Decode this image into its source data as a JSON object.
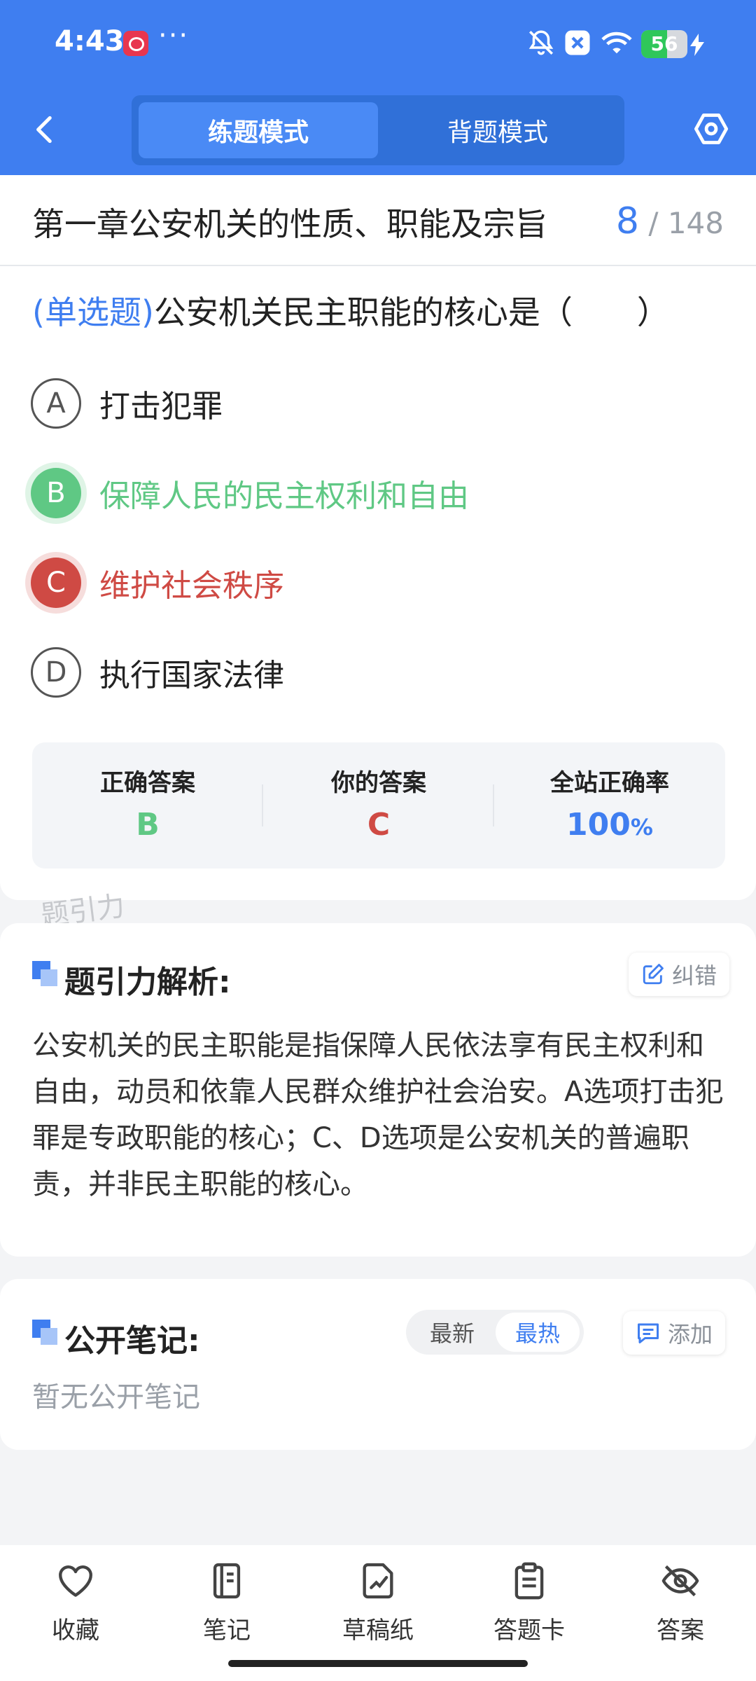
{
  "status_bar": {
    "time": "4:43",
    "more": "···",
    "battery": 56,
    "battery_text": "56"
  },
  "header": {
    "tabs": [
      {
        "label": "练题模式",
        "active": true
      },
      {
        "label": "背题模式",
        "active": false
      }
    ]
  },
  "question": {
    "chapter": "第一章公安机关的性质、职能及宗旨",
    "current": "8",
    "total": "/ 148",
    "type_tag": "(单选题)",
    "text": "公安机关民主职能的核心是（　　）",
    "options": [
      {
        "letter": "A",
        "text": "打击犯罪",
        "state": "normal"
      },
      {
        "letter": "B",
        "text": "保障人民的民主权利和自由",
        "state": "correct"
      },
      {
        "letter": "C",
        "text": "维护社会秩序",
        "state": "wrong"
      },
      {
        "letter": "D",
        "text": "执行国家法律",
        "state": "normal"
      }
    ]
  },
  "stats": {
    "correct_label": "正确答案",
    "correct_value": "B",
    "yours_label": "你的答案",
    "yours_value": "C",
    "rate_label": "全站正确率",
    "rate_value": "100",
    "rate_unit": "%"
  },
  "watermark": "题引力",
  "analysis": {
    "title": "题引力解析:",
    "report_label": "纠错",
    "text": "公安机关的民主职能是指保障人民依法享有民主权利和自由，动员和依靠人民群众维护社会治安。A选项打击犯罪是专政职能的核心；C、D选项是公安机关的普遍职责，并非民主职能的核心。"
  },
  "notes": {
    "title": "公开笔记:",
    "sort_latest": "最新",
    "sort_hot": "最热",
    "add_label": "添加",
    "empty_text": "暂无公开笔记"
  },
  "bottom_nav": [
    {
      "label": "收藏",
      "icon": "heart-icon"
    },
    {
      "label": "笔记",
      "icon": "notebook-icon"
    },
    {
      "label": "草稿纸",
      "icon": "draft-icon"
    },
    {
      "label": "答题卡",
      "icon": "answer-card-icon"
    },
    {
      "label": "答案",
      "icon": "eye-off-icon"
    }
  ],
  "colors": {
    "brand": "#3f7ef0",
    "correct": "#5fc884",
    "wrong": "#cf4a44"
  }
}
